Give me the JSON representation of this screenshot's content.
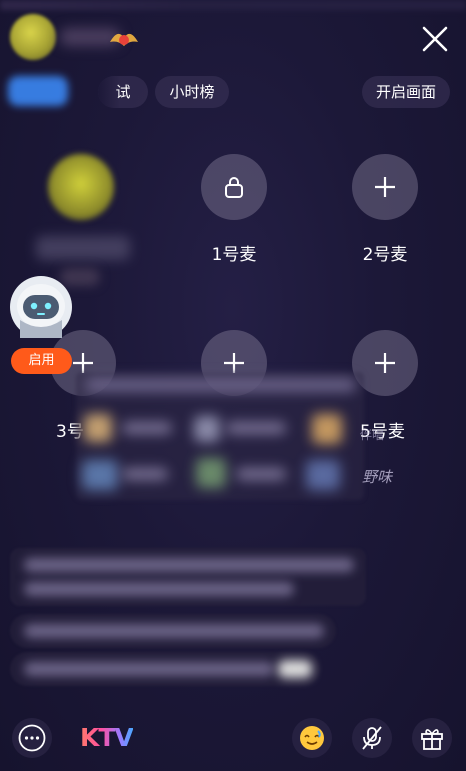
{
  "header": {
    "tabs": [
      "试",
      "小时榜"
    ],
    "open_camera": "开启画面"
  },
  "seats": [
    {
      "label": "1号麦",
      "icon": "lock-icon"
    },
    {
      "label": "2号麦",
      "icon": "plus-icon"
    },
    {
      "label": "3号",
      "icon": "plus-icon"
    },
    {
      "label": "",
      "icon": "plus-icon"
    },
    {
      "label": "5号麦",
      "icon": "plus-icon"
    }
  ],
  "robot": {
    "enable_label": "启用"
  },
  "popup_fragments": {
    "fragment_1": "伴唱",
    "fragment_2": "野味"
  },
  "bottom_bar": {
    "ktv_label": "KTV"
  },
  "colors": {
    "accent_orange": "#ff5a1a",
    "seat_bg": "#827d96",
    "background": "#1c1838"
  }
}
